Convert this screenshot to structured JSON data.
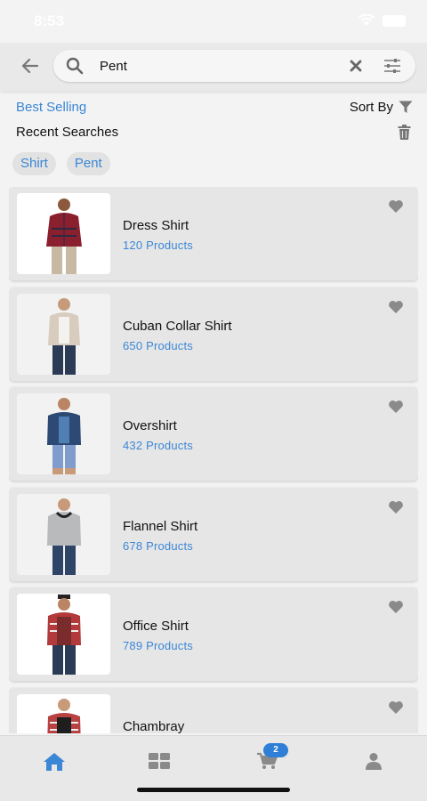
{
  "status_bar": {
    "time": "8:53"
  },
  "search": {
    "query": "Pent",
    "placeholder": ""
  },
  "toolbar": {
    "best_selling_label": "Best Selling",
    "sort_by_label": "Sort By",
    "recent_searches_label": "Recent Searches"
  },
  "recent_searches": [
    "Shirt",
    "Pent"
  ],
  "products": [
    {
      "name": "Dress Shirt",
      "count": "120 Products"
    },
    {
      "name": "Cuban Collar Shirt",
      "count": "650 Products"
    },
    {
      "name": "Overshirt",
      "count": "432 Products"
    },
    {
      "name": "Flannel Shirt",
      "count": "678 Products"
    },
    {
      "name": "Office Shirt",
      "count": "789 Products"
    },
    {
      "name": "Chambray",
      "count": ""
    }
  ],
  "bottom_nav": {
    "items": [
      "home-icon",
      "grid-icon",
      "cart-icon",
      "profile-icon"
    ],
    "active": "home-icon",
    "cart_badge": "2"
  },
  "colors": {
    "accent": "#3b87d6",
    "badge": "#2f7fd6",
    "icon_gray": "#8a8a8a",
    "card_bg": "#e6e6e6"
  }
}
